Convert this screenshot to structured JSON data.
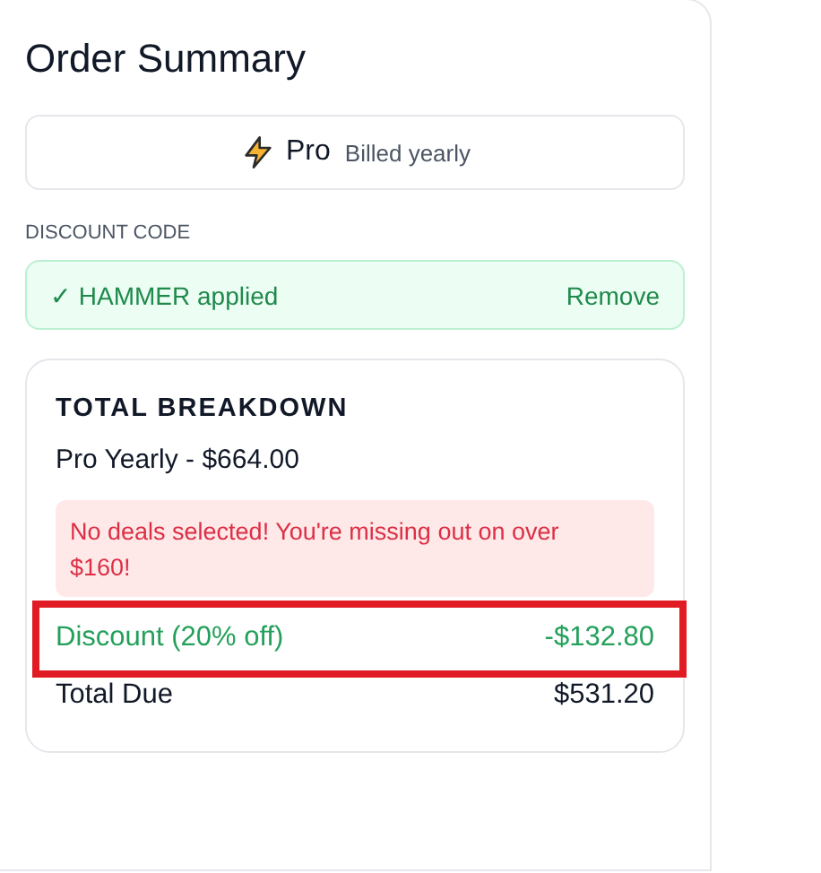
{
  "title": "Order Summary",
  "plan": {
    "name": "Pro",
    "billing": "Billed yearly"
  },
  "discount": {
    "label": "DISCOUNT CODE",
    "status": "✓ HAMMER applied",
    "action": "Remove"
  },
  "breakdown": {
    "title": "TOTAL BREAKDOWN",
    "item": "Pro Yearly - $664.00",
    "alert": "No deals selected! You're missing out on over $160!",
    "rows": [
      {
        "kind": "discount",
        "label": "Discount (20% off)",
        "amount": "-$132.80",
        "highlighted": true
      },
      {
        "kind": "total",
        "label": "Total Due",
        "amount": "$531.20",
        "highlighted": false
      }
    ]
  }
}
